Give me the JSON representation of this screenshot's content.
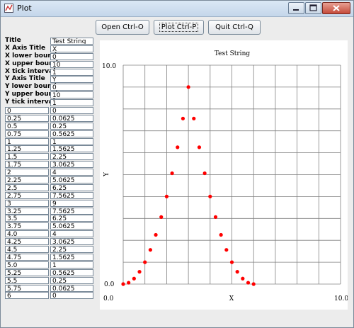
{
  "window": {
    "title": "Plot"
  },
  "toolbar": {
    "open_label": "Open  Ctrl-O",
    "plot_label": "Plot  Ctrl-P",
    "quit_label": "Quit  Ctrl-Q"
  },
  "params": [
    {
      "label": "Title",
      "value": "Test String"
    },
    {
      "label": "X Axis Title",
      "value": "X"
    },
    {
      "label": "X lower bound",
      "value": "0"
    },
    {
      "label": "X upper bound",
      "value": "10"
    },
    {
      "label": "X tick interval",
      "value": "1"
    },
    {
      "label": "Y Axis Title",
      "value": "Y"
    },
    {
      "label": "Y lower bound",
      "value": "0"
    },
    {
      "label": "Y upper bound",
      "value": "10"
    },
    {
      "label": "Y tick interval",
      "value": "1"
    }
  ],
  "data_table": [
    {
      "x": "0",
      "y": "0"
    },
    {
      "x": "0.25",
      "y": "0.0625"
    },
    {
      "x": "0.5",
      "y": "0.25"
    },
    {
      "x": "0.75",
      "y": "0.5625"
    },
    {
      "x": "1",
      "y": "1"
    },
    {
      "x": "1.25",
      "y": "1.5625"
    },
    {
      "x": "1.5",
      "y": "2.25"
    },
    {
      "x": "1.75",
      "y": "3.0625"
    },
    {
      "x": "2",
      "y": "4"
    },
    {
      "x": "2.25",
      "y": "5.0625"
    },
    {
      "x": "2.5",
      "y": "6.25"
    },
    {
      "x": "2.75",
      "y": "7.5625"
    },
    {
      "x": "3",
      "y": "9"
    },
    {
      "x": "3.25",
      "y": "7.5625"
    },
    {
      "x": "3.5",
      "y": "6.25"
    },
    {
      "x": "3.75",
      "y": "5.0625"
    },
    {
      "x": "4.0",
      "y": "4"
    },
    {
      "x": "4.25",
      "y": "3.0625"
    },
    {
      "x": "4.5",
      "y": "2.25"
    },
    {
      "x": "4.75",
      "y": "1.5625"
    },
    {
      "x": "5.0",
      "y": "1"
    },
    {
      "x": "5.25",
      "y": "0.5625"
    },
    {
      "x": "5.5",
      "y": "0.25"
    },
    {
      "x": "5.75",
      "y": "0.0625"
    },
    {
      "x": "6",
      "y": "0"
    }
  ],
  "colors": {
    "marker": "#ff0000",
    "grid": "#808080"
  },
  "chart_data": {
    "type": "scatter",
    "title": "Test String",
    "xlabel": "X",
    "ylabel": "Y",
    "xlim": [
      0,
      10
    ],
    "ylim": [
      0,
      10
    ],
    "x_tick_interval": 1,
    "y_tick_interval": 1,
    "tick_labels": {
      "x_min": "0.0",
      "x_max": "10.0",
      "y_min": "0.0",
      "y_max": "10.0"
    },
    "grid": true,
    "x": [
      0,
      0.25,
      0.5,
      0.75,
      1,
      1.25,
      1.5,
      1.75,
      2,
      2.25,
      2.5,
      2.75,
      3,
      3.25,
      3.5,
      3.75,
      4.0,
      4.25,
      4.5,
      4.75,
      5.0,
      5.25,
      5.5,
      5.75,
      6
    ],
    "y": [
      0,
      0.0625,
      0.25,
      0.5625,
      1,
      1.5625,
      2.25,
      3.0625,
      4,
      5.0625,
      6.25,
      7.5625,
      9,
      7.5625,
      6.25,
      5.0625,
      4,
      3.0625,
      2.25,
      1.5625,
      1,
      0.5625,
      0.25,
      0.0625,
      0
    ]
  }
}
